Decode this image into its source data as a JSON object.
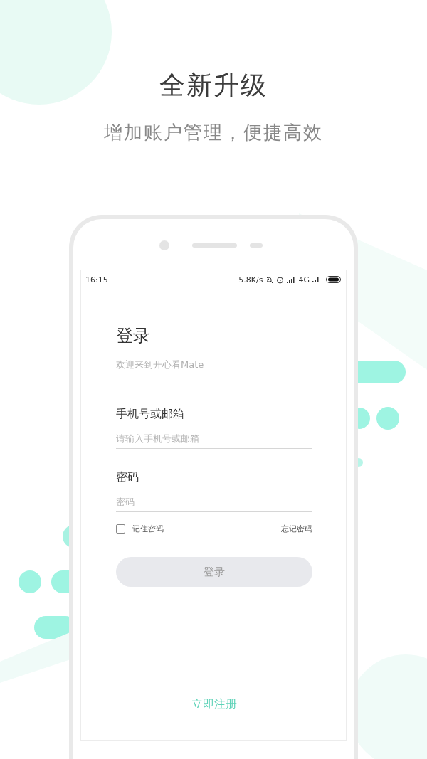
{
  "headline": {
    "title": "全新升级",
    "subtitle": "增加账户管理，便捷高效"
  },
  "status_bar": {
    "time": "16:15",
    "speed": "5.8K/s",
    "network": "4G"
  },
  "login": {
    "title": "登录",
    "welcome": "欢迎来到开心看Mate",
    "fields": [
      {
        "label": "手机号或邮箱",
        "placeholder": "请输入手机号或邮箱"
      },
      {
        "label": "密码",
        "placeholder": "密码"
      }
    ],
    "remember": {
      "label": "记住密码",
      "checked": false
    },
    "forgot": "忘记密码",
    "submit": {
      "label": "登录",
      "disabled": true
    },
    "register": "立即注册"
  }
}
